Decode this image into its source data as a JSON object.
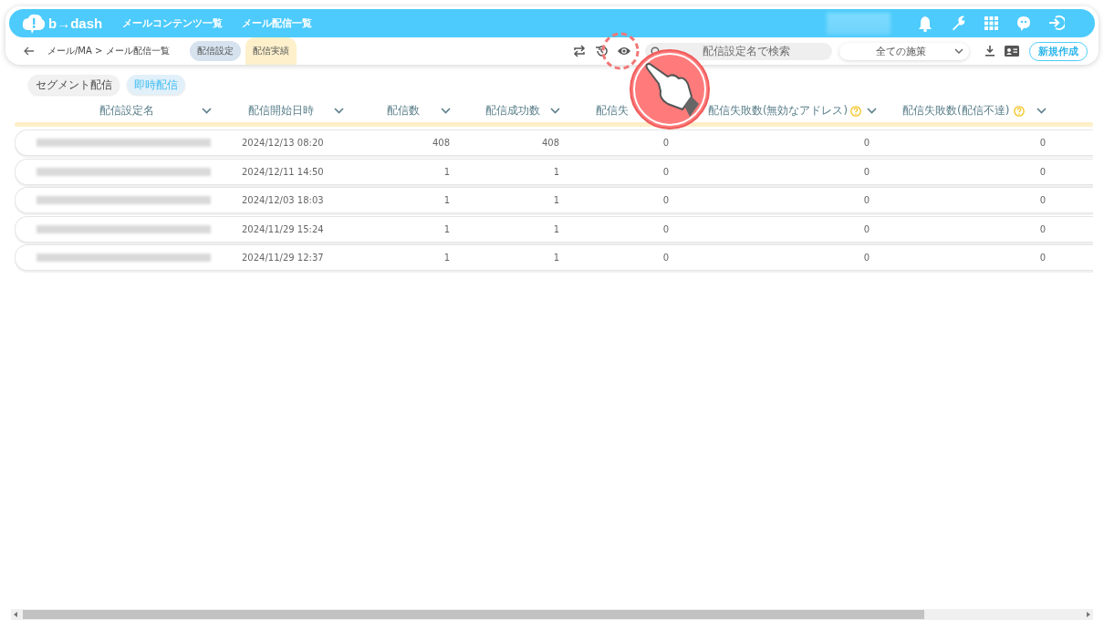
{
  "app": {
    "logo": "b→dash",
    "nav": [
      "メールコンテンツ一覧",
      "メール配信一覧"
    ],
    "user_redacted": true
  },
  "toolbar": {
    "breadcrumb": "メール/MA > メール配信一覧",
    "tabs": [
      {
        "label": "配信設定",
        "selected": false
      },
      {
        "label": "配信実績",
        "selected": true
      }
    ],
    "search": {
      "placeholder": "配信設定名で検索"
    },
    "filter": {
      "value": "全ての施策"
    },
    "new_button": "新規作成"
  },
  "subtabs": [
    {
      "label": "セグメント配信",
      "selected": false
    },
    {
      "label": "即時配信",
      "selected": true
    }
  ],
  "table": {
    "columns": [
      {
        "label": "配信設定名",
        "help": false,
        "sortable": true
      },
      {
        "label": "配信開始日時",
        "help": false,
        "sortable": true
      },
      {
        "label": "配信数",
        "help": false,
        "sortable": true
      },
      {
        "label": "配信成功数",
        "help": false,
        "sortable": true
      },
      {
        "label": "配信失",
        "help": false,
        "sortable": false
      },
      {
        "label": "配信失敗数(無効なアドレス)",
        "help": true,
        "sortable": true
      },
      {
        "label": "配信失敗数(配信不達)",
        "help": true,
        "sortable": true
      }
    ],
    "rows": [
      {
        "name_redacted": true,
        "cells": [
          "",
          "2024/12/13 08:20",
          "408",
          "408",
          "0",
          "0",
          "0"
        ]
      },
      {
        "name_redacted": true,
        "cells": [
          "",
          "2024/12/11 14:50",
          "1",
          "1",
          "0",
          "0",
          "0"
        ]
      },
      {
        "name_redacted": true,
        "cells": [
          "",
          "2024/12/03 18:03",
          "1",
          "1",
          "0",
          "0",
          "0"
        ]
      },
      {
        "name_redacted": true,
        "cells": [
          "",
          "2024/11/29 15:24",
          "1",
          "1",
          "0",
          "0",
          "0"
        ]
      },
      {
        "name_redacted": true,
        "cells": [
          "",
          "2024/11/29 12:37",
          "1",
          "1",
          "0",
          "0",
          "0"
        ]
      }
    ]
  }
}
